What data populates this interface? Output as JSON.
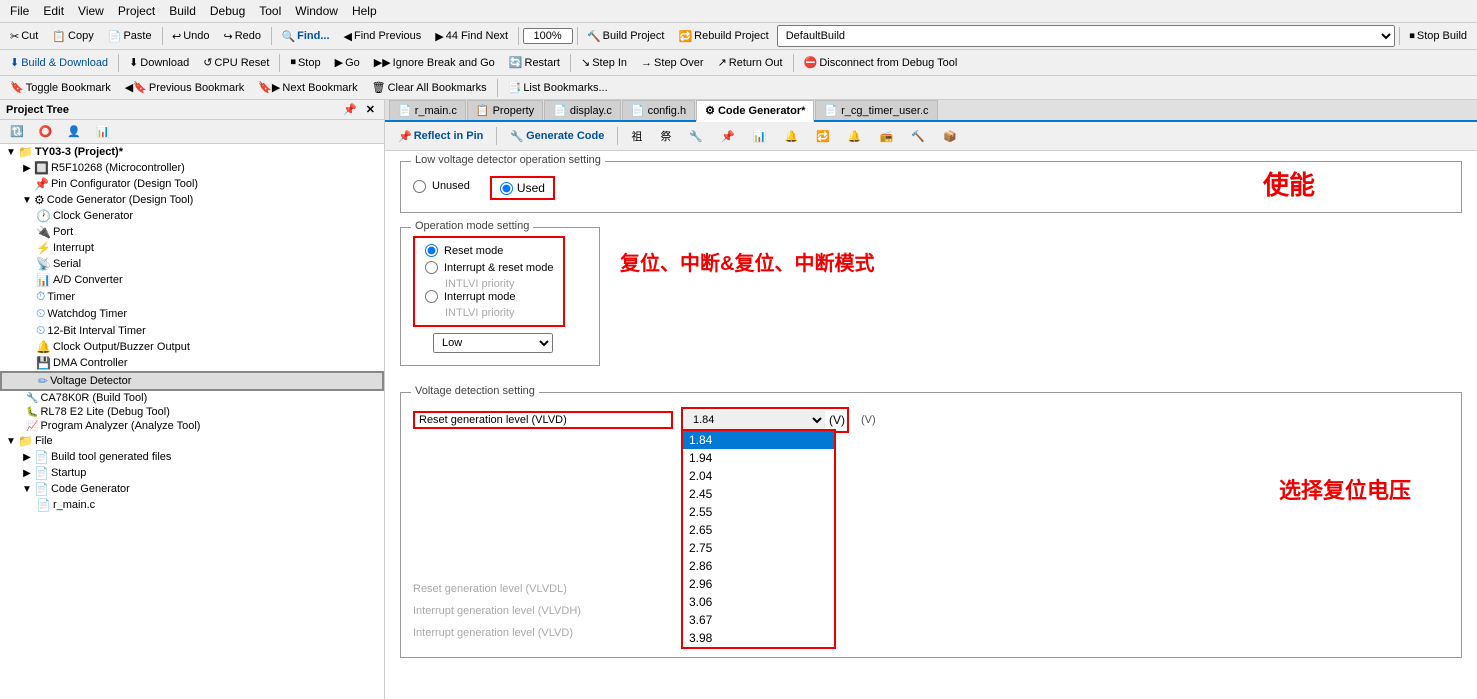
{
  "menu": {
    "items": [
      "File",
      "Edit",
      "View",
      "Project",
      "Build",
      "Debug",
      "Tool",
      "Window",
      "Help"
    ]
  },
  "toolbar1": {
    "buttons": [
      {
        "label": "Cut",
        "icon": "✂"
      },
      {
        "label": "Copy",
        "icon": "📋"
      },
      {
        "label": "Paste",
        "icon": "📄"
      },
      {
        "label": "Undo",
        "icon": "↩"
      },
      {
        "label": "Redo",
        "icon": "↪"
      },
      {
        "label": "Find...",
        "icon": "🔍"
      },
      {
        "label": "Find Previous",
        "icon": "◀🔍"
      },
      {
        "label": "44   Find Next",
        "icon": "🔍▶"
      },
      {
        "label": "100%",
        "icon": ""
      },
      {
        "label": "Build Project",
        "icon": "🔨"
      },
      {
        "label": "Rebuild Project",
        "icon": "🔁"
      },
      {
        "label": "DefaultBuild",
        "icon": ""
      },
      {
        "label": "Stop Build",
        "icon": "⏹"
      }
    ]
  },
  "toolbar2": {
    "buttons": [
      {
        "label": "Build & Download",
        "icon": "⬇"
      },
      {
        "label": "Download",
        "icon": "⬇"
      },
      {
        "label": "CPU Reset",
        "icon": "↺"
      },
      {
        "label": "Stop",
        "icon": "⏹"
      },
      {
        "label": "Go",
        "icon": "▶"
      },
      {
        "label": "Ignore Break and Go",
        "icon": "▶▶"
      },
      {
        "label": "Restart",
        "icon": "🔄"
      },
      {
        "label": "Step In",
        "icon": "↘"
      },
      {
        "label": "Step Over",
        "icon": "→"
      },
      {
        "label": "Return Out",
        "icon": "↗"
      },
      {
        "label": "Disconnect from Debug Tool",
        "icon": "⛔"
      }
    ]
  },
  "toolbar3": {
    "buttons": [
      {
        "label": "Toggle Bookmark",
        "icon": "🔖"
      },
      {
        "label": "Previous Bookmark",
        "icon": "◀🔖"
      },
      {
        "label": "Next Bookmark",
        "icon": "🔖▶"
      },
      {
        "label": "Clear All Bookmarks",
        "icon": "🗑"
      },
      {
        "label": "List Bookmarks...",
        "icon": "📑"
      }
    ]
  },
  "project_tree": {
    "header": "Project Tree",
    "nodes": [
      {
        "id": "root",
        "label": "TY03-3 (Project)*",
        "level": 0,
        "expanded": true,
        "icon": "📁",
        "type": "project"
      },
      {
        "id": "mcu",
        "label": "R5F10268 (Microcontroller)",
        "level": 1,
        "expanded": false,
        "icon": "🔲",
        "type": "mcu"
      },
      {
        "id": "pin",
        "label": "Pin Configurator (Design Tool)",
        "level": 1,
        "expanded": false,
        "icon": "📌",
        "type": "tool"
      },
      {
        "id": "codegen",
        "label": "Code Generator (Design Tool)",
        "level": 1,
        "expanded": true,
        "icon": "⚙",
        "type": "tool"
      },
      {
        "id": "clock",
        "label": "Clock Generator",
        "level": 2,
        "expanded": false,
        "icon": "🕐",
        "type": "module"
      },
      {
        "id": "port",
        "label": "Port",
        "level": 2,
        "expanded": false,
        "icon": "🔌",
        "type": "module"
      },
      {
        "id": "interrupt",
        "label": "Interrupt",
        "level": 2,
        "expanded": false,
        "icon": "⚡",
        "type": "module"
      },
      {
        "id": "serial",
        "label": "Serial",
        "level": 2,
        "expanded": false,
        "icon": "📡",
        "type": "module"
      },
      {
        "id": "adc",
        "label": "A/D Converter",
        "level": 2,
        "expanded": false,
        "icon": "📊",
        "type": "module"
      },
      {
        "id": "timer",
        "label": "Timer",
        "level": 2,
        "expanded": false,
        "icon": "⏱",
        "type": "module"
      },
      {
        "id": "watchdog",
        "label": "Watchdog Timer",
        "level": 2,
        "expanded": false,
        "icon": "🐕",
        "type": "module"
      },
      {
        "id": "interval",
        "label": "12-Bit Interval Timer",
        "level": 2,
        "expanded": false,
        "icon": "⏲",
        "type": "module"
      },
      {
        "id": "clock_out",
        "label": "Clock Output/Buzzer Output",
        "level": 2,
        "expanded": false,
        "icon": "🔔",
        "type": "module"
      },
      {
        "id": "dma",
        "label": "DMA Controller",
        "level": 2,
        "expanded": false,
        "icon": "💾",
        "type": "module"
      },
      {
        "id": "voltage",
        "label": "Voltage Detector",
        "level": 2,
        "expanded": false,
        "icon": "⚡",
        "type": "module",
        "selected": true
      },
      {
        "id": "ca78k0r",
        "label": "CA78K0R (Build Tool)",
        "level": 1,
        "expanded": false,
        "icon": "🔨",
        "type": "tool"
      },
      {
        "id": "rl78",
        "label": "RL78 E2 Lite (Debug Tool)",
        "level": 1,
        "expanded": false,
        "icon": "🐛",
        "type": "tool"
      },
      {
        "id": "program",
        "label": "Program Analyzer (Analyze Tool)",
        "level": 1,
        "expanded": false,
        "icon": "📈",
        "type": "tool"
      },
      {
        "id": "file",
        "label": "File",
        "level": 0,
        "expanded": true,
        "icon": "📁",
        "type": "folder"
      },
      {
        "id": "build_files",
        "label": "Build tool generated files",
        "level": 1,
        "expanded": false,
        "icon": "📄",
        "type": "folder"
      },
      {
        "id": "startup",
        "label": "Startup",
        "level": 1,
        "expanded": false,
        "icon": "📄",
        "type": "folder"
      },
      {
        "id": "codegen2",
        "label": "Code Generator",
        "level": 1,
        "expanded": false,
        "icon": "📄",
        "type": "folder"
      },
      {
        "id": "r_main",
        "label": "r_main.c",
        "level": 2,
        "expanded": false,
        "icon": "📄",
        "type": "file"
      }
    ]
  },
  "tabs": [
    {
      "label": "r_main.c",
      "active": false,
      "icon": "📄"
    },
    {
      "label": "Property",
      "active": false,
      "icon": "📋"
    },
    {
      "label": "display.c",
      "active": false,
      "icon": "📄"
    },
    {
      "label": "config.h",
      "active": false,
      "icon": "📄"
    },
    {
      "label": "Code Generator*",
      "active": true,
      "icon": "⚙"
    },
    {
      "label": "r_cg_timer_user.c",
      "active": false,
      "icon": "📄"
    }
  ],
  "codegen_toolbar": {
    "reflect_in_pin": "Reflect in Pin",
    "generate_code": "Generate Code",
    "icons": [
      "祖",
      "祭",
      "🔧",
      "📌",
      "📊",
      "🔔",
      "🔁",
      "🔔",
      "📻",
      "🔨",
      "📦"
    ]
  },
  "content": {
    "low_voltage_section": "Low voltage detector operation setting",
    "unused_label": "Unused",
    "used_label": "Used",
    "annotation_used": "使能",
    "operation_mode_section": "Operation mode setting",
    "reset_mode": "Reset mode",
    "interrupt_reset_mode": "Interrupt & reset mode",
    "intlvi_priority1": "INTLVI priority",
    "interrupt_mode": "Interrupt mode",
    "intlvi_priority2": "INTLVI priority",
    "annotation_opmode": "复位、中断&复位、中断模式",
    "low_option": "Low",
    "voltage_detection_section": "Voltage detection setting",
    "reset_gen_level": "Reset generation level (VLVD)",
    "reset_gen_level_dl": "Reset generation level (VLVDL)",
    "interrupt_gen_level_h": "Interrupt generation level (VLVDH)",
    "interrupt_gen_level": "Interrupt generation level (VLVD)",
    "annotation_voltage": "选择复位电压",
    "current_voltage": "1.84",
    "voltage_unit": "(V)",
    "voltage_options": [
      "1.84",
      "1.94",
      "2.04",
      "2.45",
      "2.55",
      "2.65",
      "2.75",
      "2.86",
      "2.96",
      "3.06",
      "3.67",
      "3.98"
    ]
  }
}
